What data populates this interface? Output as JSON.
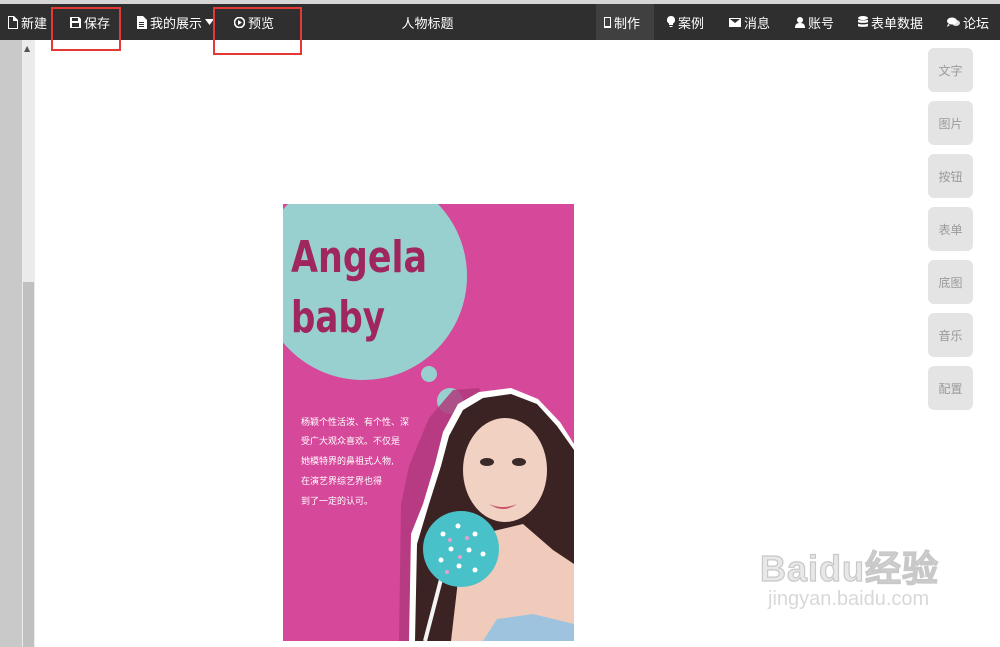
{
  "toolbar": {
    "new_label": "新建",
    "save_label": "保存",
    "my_show_label": "我的展示",
    "preview_label": "预览",
    "page_title": "人物标题",
    "nav": [
      {
        "label": "制作"
      },
      {
        "label": "案例"
      },
      {
        "label": "消息"
      },
      {
        "label": "账号"
      },
      {
        "label": "表单数据"
      },
      {
        "label": "论坛"
      }
    ]
  },
  "poster": {
    "headline_line1": "Angela",
    "headline_line2": "baby",
    "body_lines": [
      "杨颖个性活泼、有个性、深",
      "受广大观众喜欢。不仅是",
      "她模特界的鼻祖式人物,",
      "在演艺界综艺界也得",
      "到了一定的认可。"
    ]
  },
  "side_tools": [
    {
      "label": "文字"
    },
    {
      "label": "图片"
    },
    {
      "label": "按钮"
    },
    {
      "label": "表单"
    },
    {
      "label": "底图"
    },
    {
      "label": "音乐"
    },
    {
      "label": "配置"
    }
  ],
  "watermark": {
    "logo": "Baidu经验",
    "url": "jingyan.baidu.com"
  },
  "colors": {
    "toolbar_bg": "#2f2f2f",
    "poster_bg": "#d6489a",
    "poster_circle": "#98d0cf",
    "headline": "#a0265e",
    "highlight": "#e53935"
  }
}
